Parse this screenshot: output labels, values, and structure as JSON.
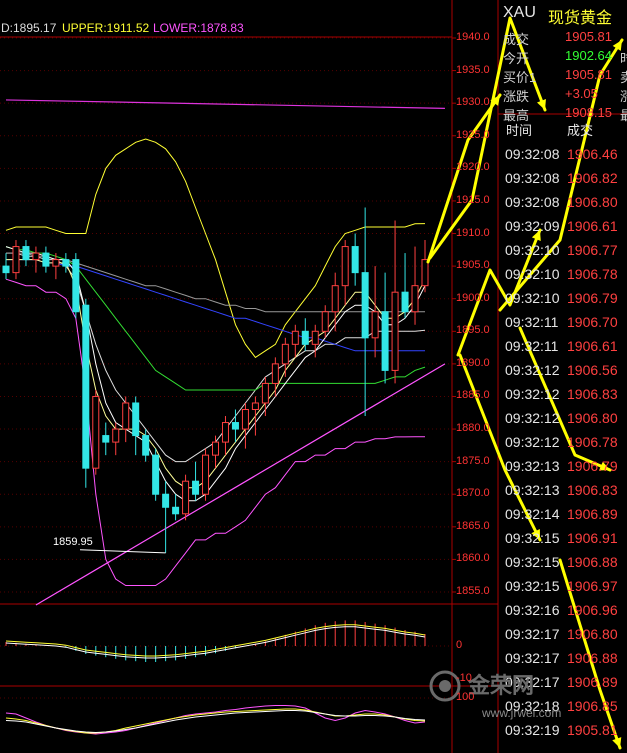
{
  "indicator_bar": {
    "mid": "D:1895.17",
    "upper": "UPPER:1911.52",
    "lower": "LOWER:1878.83",
    "colors": {
      "mid": "#dddddd",
      "upper": "#ffff33",
      "lower": "#ff55ff"
    }
  },
  "quote_panel": {
    "symbol": "XAU",
    "name": "现货黄金",
    "rows": [
      {
        "label": "成交",
        "value": "1905.81",
        "color": "#ff4040",
        "tail": ""
      },
      {
        "label": "今开",
        "value": "1902.64",
        "color": "#33ff33",
        "tail": "时"
      },
      {
        "label": "买价1",
        "value": "1905.81",
        "color": "#ff4040",
        "tail": "卖"
      },
      {
        "label": "涨跌",
        "value": "+3.05",
        "color": "#ff4040",
        "tail": "涨"
      },
      {
        "label": "最高",
        "value": "1908.15",
        "color": "#ff4040",
        "tail": "最"
      }
    ]
  },
  "trades": {
    "header_time": "时间",
    "header_price": "成交",
    "rows": [
      {
        "time": "09:32:08",
        "price": "1906.46"
      },
      {
        "time": "09:32:08",
        "price": "1906.82"
      },
      {
        "time": "09:32:08",
        "price": "1906.80"
      },
      {
        "time": "09:32:09",
        "price": "1906.61"
      },
      {
        "time": "09:32:10",
        "price": "1906.77"
      },
      {
        "time": "09:32:10",
        "price": "1906.78"
      },
      {
        "time": "09:32:10",
        "price": "1906.79"
      },
      {
        "time": "09:32:11",
        "price": "1906.70"
      },
      {
        "time": "09:32:11",
        "price": "1906.61"
      },
      {
        "time": "09:32:12",
        "price": "1906.56"
      },
      {
        "time": "09:32:12",
        "price": "1906.83"
      },
      {
        "time": "09:32:12",
        "price": "1906.80"
      },
      {
        "time": "09:32:12",
        "price": "1906.78"
      },
      {
        "time": "09:32:13",
        "price": "1906.79"
      },
      {
        "time": "09:32:13",
        "price": "1906.83"
      },
      {
        "time": "09:32:14",
        "price": "1906.89"
      },
      {
        "time": "09:32:15",
        "price": "1906.91"
      },
      {
        "time": "09:32:15",
        "price": "1906.88"
      },
      {
        "time": "09:32:15",
        "price": "1906.97"
      },
      {
        "time": "09:32:16",
        "price": "1906.96"
      },
      {
        "time": "09:32:17",
        "price": "1906.80"
      },
      {
        "time": "09:32:17",
        "price": "1906.88"
      },
      {
        "time": "09:32:17",
        "price": "1906.89"
      },
      {
        "time": "09:32:18",
        "price": "1906.85"
      },
      {
        "time": "09:32:19",
        "price": "1905.81"
      }
    ]
  },
  "watermark": {
    "text": "金荣网",
    "url": "www.jrwei.com"
  },
  "chart_data": [
    {
      "type": "candlestick",
      "ylim": [
        1855,
        1940
      ],
      "yticks": [
        1940,
        1935,
        1930,
        1925,
        1920,
        1915,
        1910,
        1905,
        1900,
        1895,
        1890,
        1885,
        1880,
        1875,
        1870,
        1865,
        1860,
        1855
      ],
      "annotations": [
        {
          "label": "1859.95",
          "value": 1859.95
        }
      ],
      "candles": [
        {
          "o": 1905,
          "h": 1907,
          "l": 1903,
          "c": 1904
        },
        {
          "o": 1904,
          "h": 1909,
          "l": 1903,
          "c": 1908
        },
        {
          "o": 1908,
          "h": 1909,
          "l": 1905,
          "c": 1906
        },
        {
          "o": 1906,
          "h": 1908,
          "l": 1904,
          "c": 1907
        },
        {
          "o": 1907,
          "h": 1908,
          "l": 1904,
          "c": 1905
        },
        {
          "o": 1905,
          "h": 1907,
          "l": 1903,
          "c": 1906
        },
        {
          "o": 1906,
          "h": 1907,
          "l": 1904,
          "c": 1905
        },
        {
          "o": 1906,
          "h": 1907,
          "l": 1897,
          "c": 1898
        },
        {
          "o": 1899,
          "h": 1900,
          "l": 1871,
          "c": 1874
        },
        {
          "o": 1874,
          "h": 1886,
          "l": 1873,
          "c": 1885
        },
        {
          "o": 1879,
          "h": 1881,
          "l": 1876,
          "c": 1878
        },
        {
          "o": 1878,
          "h": 1881,
          "l": 1876,
          "c": 1880
        },
        {
          "o": 1880,
          "h": 1885,
          "l": 1878,
          "c": 1884
        },
        {
          "o": 1884,
          "h": 1885,
          "l": 1876,
          "c": 1879
        },
        {
          "o": 1879,
          "h": 1880,
          "l": 1875,
          "c": 1876
        },
        {
          "o": 1876,
          "h": 1877,
          "l": 1869,
          "c": 1870
        },
        {
          "o": 1870,
          "h": 1872,
          "l": 1861,
          "c": 1868
        },
        {
          "o": 1868,
          "h": 1870,
          "l": 1866,
          "c": 1867
        },
        {
          "o": 1867,
          "h": 1873,
          "l": 1866,
          "c": 1872
        },
        {
          "o": 1872,
          "h": 1875,
          "l": 1869,
          "c": 1870
        },
        {
          "o": 1870,
          "h": 1877,
          "l": 1869,
          "c": 1876
        },
        {
          "o": 1876,
          "h": 1879,
          "l": 1874,
          "c": 1878
        },
        {
          "o": 1878,
          "h": 1882,
          "l": 1876,
          "c": 1881
        },
        {
          "o": 1881,
          "h": 1883,
          "l": 1878,
          "c": 1880
        },
        {
          "o": 1880,
          "h": 1884,
          "l": 1877,
          "c": 1883
        },
        {
          "o": 1883,
          "h": 1885,
          "l": 1879,
          "c": 1884
        },
        {
          "o": 1884,
          "h": 1888,
          "l": 1882,
          "c": 1887
        },
        {
          "o": 1887,
          "h": 1891,
          "l": 1885,
          "c": 1890
        },
        {
          "o": 1890,
          "h": 1894,
          "l": 1888,
          "c": 1893
        },
        {
          "o": 1893,
          "h": 1896,
          "l": 1891,
          "c": 1895
        },
        {
          "o": 1895,
          "h": 1897,
          "l": 1892,
          "c": 1893
        },
        {
          "o": 1893,
          "h": 1896,
          "l": 1891,
          "c": 1895
        },
        {
          "o": 1895,
          "h": 1899,
          "l": 1894,
          "c": 1898
        },
        {
          "o": 1898,
          "h": 1904,
          "l": 1895,
          "c": 1902
        },
        {
          "o": 1902,
          "h": 1909,
          "l": 1899,
          "c": 1908
        },
        {
          "o": 1908,
          "h": 1910,
          "l": 1902,
          "c": 1904
        },
        {
          "o": 1904,
          "h": 1914,
          "l": 1882,
          "c": 1894
        },
        {
          "o": 1894,
          "h": 1905,
          "l": 1891,
          "c": 1898
        },
        {
          "o": 1898,
          "h": 1904,
          "l": 1887,
          "c": 1889
        },
        {
          "o": 1889,
          "h": 1912,
          "l": 1887,
          "c": 1901
        },
        {
          "o": 1901,
          "h": 1907,
          "l": 1897,
          "c": 1898
        },
        {
          "o": 1898,
          "h": 1908,
          "l": 1896,
          "c": 1902
        },
        {
          "o": 1902,
          "h": 1909,
          "l": 1901,
          "c": 1906
        }
      ],
      "series": [
        {
          "color": "#ffff33",
          "values": [
            1910.5,
            1911,
            1911,
            1911,
            1911,
            1910.5,
            1910,
            1910,
            1910,
            1916,
            1920,
            1922,
            1923,
            1924,
            1924.5,
            1924,
            1923,
            1921,
            1918,
            1914,
            1910,
            1906,
            1901,
            1896,
            1893,
            1891,
            1892,
            1893,
            1896,
            1898,
            1900,
            1902,
            1905,
            1908,
            1910,
            1910.5,
            1911,
            1911,
            1911,
            1911,
            1911,
            1911.5,
            1911.52
          ]
        },
        {
          "color": "#dddddd",
          "values": [
            1907,
            1907,
            1906.5,
            1906.5,
            1906,
            1906,
            1905,
            1903,
            1898,
            1893,
            1889,
            1886,
            1884,
            1882,
            1880,
            1878,
            1876,
            1875,
            1875,
            1876,
            1877,
            1878,
            1880,
            1882,
            1884,
            1886,
            1888,
            1889,
            1890,
            1891,
            1892,
            1892,
            1893,
            1893,
            1894,
            1894,
            1894,
            1895,
            1895,
            1895,
            1895,
            1895,
            1895.17
          ]
        },
        {
          "color": "#ff55ff",
          "values": [
            1903,
            1902.5,
            1902,
            1902,
            1901,
            1901,
            1900,
            1897,
            1886,
            1870,
            1860,
            1857,
            1856,
            1856,
            1856,
            1856,
            1857,
            1859,
            1861,
            1863,
            1863,
            1864,
            1864,
            1865,
            1866,
            1868,
            1870,
            1871,
            1873,
            1875,
            1875,
            1876,
            1876,
            1877,
            1877,
            1878,
            1878,
            1878.5,
            1878.5,
            1878.8,
            1878.8,
            1878.83,
            1878.83
          ]
        },
        {
          "color": "#33dd33",
          "values": [
            1908,
            1907.5,
            1907.5,
            1907,
            1907,
            1906.5,
            1906,
            1905,
            1903,
            1901,
            1899,
            1897,
            1895,
            1893,
            1891,
            1889,
            1888,
            1887,
            1886,
            1886,
            1886,
            1886,
            1886,
            1886,
            1886,
            1886,
            1887,
            1887,
            1887,
            1887,
            1887,
            1887,
            1887,
            1887,
            1887,
            1887,
            1887,
            1887,
            1887.5,
            1888,
            1888,
            1889,
            1889.5
          ]
        },
        {
          "color": "#3344ff",
          "values": [
            1906,
            1906,
            1906,
            1906,
            1905.5,
            1905.5,
            1905,
            1905,
            1904.5,
            1904,
            1903.5,
            1903,
            1902.5,
            1902,
            1901.5,
            1901,
            1900.5,
            1900,
            1899.5,
            1899,
            1898.5,
            1898,
            1897.5,
            1897,
            1897,
            1896.5,
            1896,
            1895.5,
            1895,
            1894.5,
            1894,
            1894,
            1893.5,
            1893,
            1892.5,
            1892,
            1892,
            1892,
            1892,
            1892,
            1892,
            1892,
            1892
          ]
        },
        {
          "color": "#999999",
          "values": [
            1907,
            1907,
            1907,
            1906.5,
            1906.5,
            1906,
            1906,
            1905.5,
            1905,
            1904.5,
            1904,
            1903.5,
            1903,
            1902.5,
            1902,
            1902,
            1901.5,
            1901,
            1900.5,
            1900,
            1900,
            1899.5,
            1899,
            1899,
            1898.5,
            1898.5,
            1898,
            1898,
            1898,
            1898,
            1898,
            1898,
            1898,
            1898,
            1898,
            1898,
            1898,
            1898,
            1898,
            1898,
            1898,
            1898,
            1898
          ]
        },
        {
          "color": "#ffffff",
          "values": [
            1908,
            1907.5,
            1907,
            1907,
            1906.5,
            1906,
            1906,
            1904,
            1898,
            1890,
            1884,
            1881,
            1880,
            1879,
            1878,
            1875,
            1872,
            1870,
            1869,
            1869,
            1870,
            1872,
            1874,
            1877,
            1879,
            1881,
            1883,
            1885,
            1887,
            1889,
            1891,
            1892,
            1894,
            1896,
            1898,
            1899,
            1899,
            1898,
            1896,
            1896,
            1897,
            1899,
            1902
          ]
        },
        {
          "color": "#ffff99",
          "values": [
            1906,
            1906,
            1906,
            1906,
            1905.5,
            1905.5,
            1905.5,
            1902,
            1893,
            1886,
            1882,
            1880,
            1880,
            1880,
            1879,
            1877,
            1874,
            1872,
            1871,
            1871,
            1872,
            1874,
            1876,
            1878,
            1880,
            1882,
            1884,
            1886,
            1889,
            1891,
            1893,
            1894,
            1895,
            1897,
            1899,
            1901,
            1901,
            1899,
            1897,
            1897,
            1898,
            1900,
            1903
          ]
        }
      ],
      "trendline": [
        {
          "x": 3,
          "y": 1853
        },
        {
          "x": 44,
          "y": 1890
        }
      ],
      "extra_lines": [
        {
          "color": "#dd33dd",
          "points": [
            {
              "x": 0,
              "y": 1930.5
            },
            {
              "x": 44,
              "y": 1929.2
            }
          ]
        }
      ]
    },
    {
      "type": "bar",
      "ylabel_ticks": [
        "0",
        "-10"
      ],
      "values": [
        0.5,
        0.4,
        0.3,
        0.2,
        0.1,
        0,
        -0.2,
        -0.6,
        -1.0,
        -1.2,
        -1.4,
        -1.6,
        -1.8,
        -1.9,
        -2.0,
        -2.0,
        -1.9,
        -1.8,
        -1.6,
        -1.4,
        -1.2,
        -0.9,
        -0.6,
        -0.3,
        0,
        0.3,
        0.6,
        1.0,
        1.4,
        1.8,
        2.2,
        2.6,
        2.9,
        3.1,
        3.2,
        3.2,
        3.0,
        2.8,
        2.6,
        2.3,
        2.0,
        1.8,
        1.5
      ]
    },
    {
      "type": "line",
      "ylabel_ticks": [
        "100"
      ],
      "series": [
        {
          "color": "#ff55ff",
          "values": [
            70,
            68,
            60,
            52,
            45,
            40,
            35,
            32,
            30,
            28,
            30,
            32,
            35,
            40,
            45,
            50,
            55,
            60,
            65,
            68,
            70,
            72,
            75,
            77,
            80,
            82,
            84,
            85,
            85,
            84,
            80,
            70,
            60,
            55,
            60,
            70,
            75,
            72,
            68,
            62,
            55,
            50,
            52
          ]
        },
        {
          "color": "#ffff33",
          "values": [
            60,
            58,
            55,
            50,
            45,
            40,
            36,
            33,
            30,
            30,
            32,
            35,
            40,
            44,
            48,
            52,
            56,
            60,
            63,
            66,
            68,
            70,
            72,
            73,
            74,
            75,
            76,
            77,
            78,
            78,
            76,
            72,
            68,
            64,
            64,
            66,
            68,
            68,
            66,
            62,
            58,
            55,
            54
          ]
        },
        {
          "color": "#ffffff",
          "values": [
            55,
            54,
            52,
            48,
            44,
            40,
            37,
            34,
            32,
            31,
            32,
            34,
            37,
            40,
            44,
            48,
            52,
            56,
            59,
            62,
            64,
            66,
            68,
            70,
            71,
            72,
            73,
            74,
            75,
            75,
            74,
            71,
            68,
            65,
            64,
            64,
            65,
            65,
            64,
            62,
            59,
            57,
            56
          ]
        }
      ]
    }
  ]
}
